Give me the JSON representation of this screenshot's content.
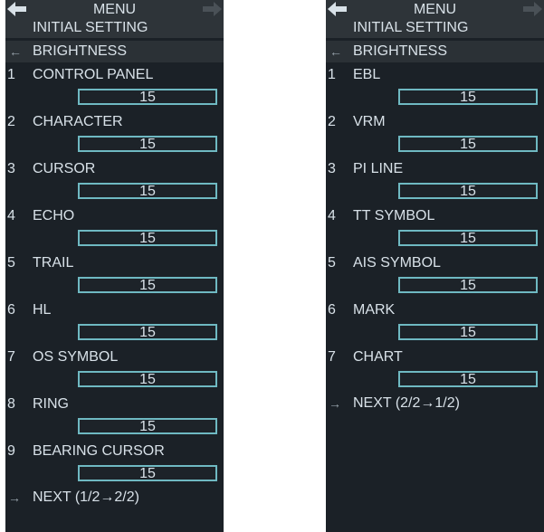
{
  "left": {
    "header_title": "MENU",
    "menu_title": "INITIAL SETTING",
    "breadcrumb": "BRIGHTNESS",
    "items": [
      {
        "num": "1",
        "label": "CONTROL PANEL",
        "value": "15"
      },
      {
        "num": "2",
        "label": "CHARACTER",
        "value": "15"
      },
      {
        "num": "3",
        "label": "CURSOR",
        "value": "15"
      },
      {
        "num": "4",
        "label": "ECHO",
        "value": "15"
      },
      {
        "num": "5",
        "label": "TRAIL",
        "value": "15"
      },
      {
        "num": "6",
        "label": "HL",
        "value": "15"
      },
      {
        "num": "7",
        "label": "OS SYMBOL",
        "value": "15"
      },
      {
        "num": "8",
        "label": "RING",
        "value": "15"
      },
      {
        "num": "9",
        "label": "BEARING CURSOR",
        "value": "15"
      }
    ],
    "next": "NEXT (1/2→2/2)"
  },
  "right": {
    "header_title": "MENU",
    "menu_title": "INITIAL SETTING",
    "breadcrumb": "BRIGHTNESS",
    "items": [
      {
        "num": "1",
        "label": "EBL",
        "value": "15"
      },
      {
        "num": "2",
        "label": "VRM",
        "value": "15"
      },
      {
        "num": "3",
        "label": "PI LINE",
        "value": "15"
      },
      {
        "num": "4",
        "label": "TT SYMBOL",
        "value": "15"
      },
      {
        "num": "5",
        "label": "AIS SYMBOL",
        "value": "15"
      },
      {
        "num": "6",
        "label": "MARK",
        "value": "15"
      },
      {
        "num": "7",
        "label": "CHART",
        "value": "15"
      }
    ],
    "next": "NEXT (2/2→1/2)"
  },
  "icons": {
    "back_arrow": "left-arrow-icon",
    "forward_arrow": "right-arrow-icon",
    "breadcrumb_back": "back-arrow-icon",
    "next_arrow": "next-arrow-icon"
  },
  "colors": {
    "panel_bg": "#1b2127",
    "bar_bg": "#2e3439",
    "text": "#d8e1e8",
    "box_border": "#6fb9c2"
  }
}
